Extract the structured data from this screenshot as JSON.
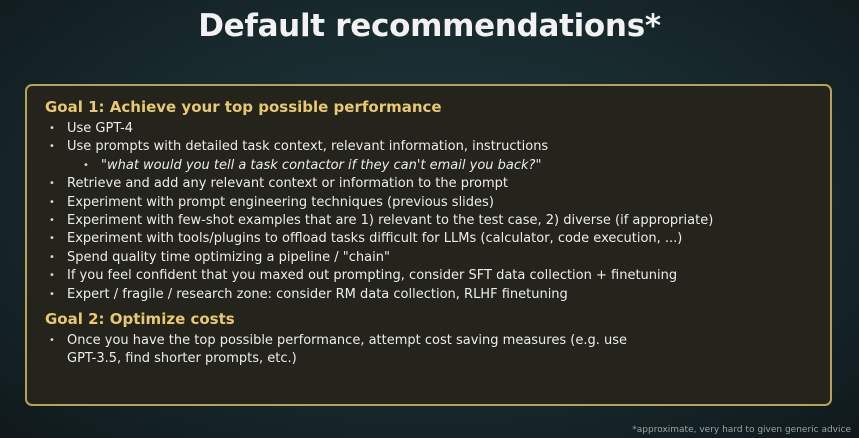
{
  "title": "Default recommendations*",
  "goal1": {
    "title": "Goal 1: Achieve your top possible performance",
    "items": [
      "Use GPT-4",
      "Use prompts with detailed task context, relevant information, instructions",
      "\"what would you tell a task contactor if they can't email you back?\"",
      "Retrieve and add any relevant context or information to the prompt",
      "Experiment with prompt engineering techniques (previous slides)",
      "Experiment with few-shot examples that are 1) relevant to the test case, 2) diverse (if appropriate)",
      "Experiment with tools/plugins to offload tasks difficult for LLMs (calculator, code execution, ...)",
      "Spend quality time optimizing a pipeline / \"chain\"",
      "If you feel confident that you maxed out prompting, consider SFT data collection + finetuning",
      "Expert / fragile / research zone: consider RM data collection, RLHF finetuning"
    ]
  },
  "goal2": {
    "title": "Goal 2: Optimize costs",
    "items": [
      "Once you have the top possible performance, attempt cost saving measures (e.g. use GPT-3.5, find shorter prompts, etc.)"
    ]
  },
  "footnote": "*approximate, very hard to given generic advice"
}
